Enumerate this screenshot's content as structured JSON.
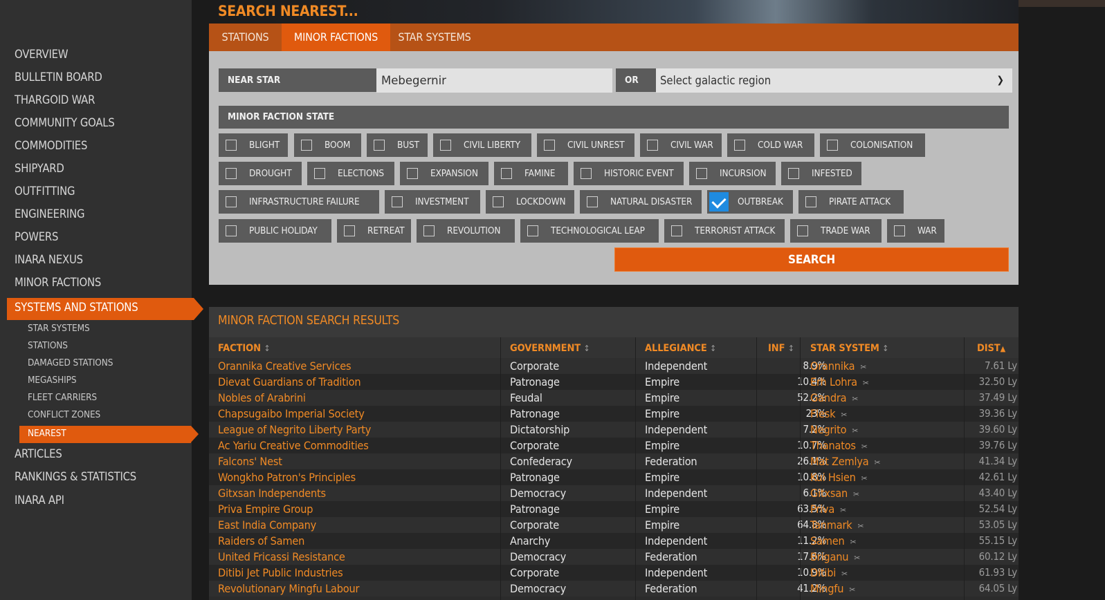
{
  "sidebar": {
    "items": [
      {
        "label": "OVERVIEW"
      },
      {
        "label": "BULLETIN BOARD"
      },
      {
        "label": "THARGOID WAR"
      },
      {
        "label": "COMMUNITY GOALS"
      },
      {
        "label": "COMMODITIES"
      },
      {
        "label": "SHIPYARD"
      },
      {
        "label": "OUTFITTING"
      },
      {
        "label": "ENGINEERING"
      },
      {
        "label": "POWERS"
      },
      {
        "label": "INARA NEXUS"
      },
      {
        "label": "MINOR FACTIONS"
      },
      {
        "label": "SYSTEMS AND STATIONS",
        "active": true
      },
      {
        "label": "ARTICLES"
      },
      {
        "label": "RANKINGS & STATISTICS"
      },
      {
        "label": "INARA API"
      }
    ],
    "subitems": [
      {
        "label": "STAR SYSTEMS"
      },
      {
        "label": "STATIONS"
      },
      {
        "label": "DAMAGED STATIONS"
      },
      {
        "label": "MEGASHIPS"
      },
      {
        "label": "FLEET CARRIERS"
      },
      {
        "label": "CONFLICT ZONES"
      },
      {
        "label": "NEAREST",
        "active": true
      }
    ]
  },
  "header": {
    "title": "SEARCH NEAREST..."
  },
  "tabs": [
    {
      "label": "STATIONS"
    },
    {
      "label": "MINOR FACTIONS",
      "active": true
    },
    {
      "label": "STAR SYSTEMS"
    }
  ],
  "form": {
    "near_star_label": "NEAR STAR",
    "near_star_value": "Mebegernir",
    "or_label": "OR",
    "region_select": "Select galactic region",
    "state_label": "MINOR FACTION STATE",
    "states": [
      {
        "label": "BLIGHT",
        "checked": false
      },
      {
        "label": "BOOM",
        "checked": false
      },
      {
        "label": "BUST",
        "checked": false
      },
      {
        "label": "CIVIL LIBERTY",
        "checked": false
      },
      {
        "label": "CIVIL UNREST",
        "checked": false
      },
      {
        "label": "CIVIL WAR",
        "checked": false
      },
      {
        "label": "COLD WAR",
        "checked": false
      },
      {
        "label": "COLONISATION",
        "checked": false
      },
      {
        "label": "DROUGHT",
        "checked": false
      },
      {
        "label": "ELECTIONS",
        "checked": false
      },
      {
        "label": "EXPANSION",
        "checked": false
      },
      {
        "label": "FAMINE",
        "checked": false
      },
      {
        "label": "HISTORIC EVENT",
        "checked": false
      },
      {
        "label": "INCURSION",
        "checked": false
      },
      {
        "label": "INFESTED",
        "checked": false
      },
      {
        "label": "INFRASTRUCTURE FAILURE",
        "checked": false
      },
      {
        "label": "INVESTMENT",
        "checked": false
      },
      {
        "label": "LOCKDOWN",
        "checked": false
      },
      {
        "label": "NATURAL DISASTER",
        "checked": false
      },
      {
        "label": "OUTBREAK",
        "checked": true
      },
      {
        "label": "PIRATE ATTACK",
        "checked": false
      },
      {
        "label": "PUBLIC HOLIDAY",
        "checked": false
      },
      {
        "label": "RETREAT",
        "checked": false
      },
      {
        "label": "REVOLUTION",
        "checked": false
      },
      {
        "label": "TECHNOLOGICAL LEAP",
        "checked": false
      },
      {
        "label": "TERRORIST ATTACK",
        "checked": false
      },
      {
        "label": "TRADE WAR",
        "checked": false
      },
      {
        "label": "WAR",
        "checked": false
      }
    ],
    "search_label": "SEARCH"
  },
  "results": {
    "title": "MINOR FACTION SEARCH RESULTS",
    "columns": [
      "FACTION",
      "GOVERNMENT",
      "ALLEGIANCE",
      "INF",
      "STAR SYSTEM",
      "DIST"
    ],
    "rows": [
      [
        "Orannika Creative Services",
        "Corporate",
        "Independent",
        "8.9%",
        "Orannika",
        "7.61 Ly"
      ],
      [
        "Dievat Guardians of Tradition",
        "Patronage",
        "Empire",
        "10.4%",
        "Erh Lohra",
        "32.50 Ly"
      ],
      [
        "Nobles of Arabrini",
        "Feudal",
        "Empire",
        "52.2%",
        "Gandra",
        "37.49 Ly"
      ],
      [
        "Chapsugaibo Imperial Society",
        "Patronage",
        "Empire",
        "23%",
        "Flesk",
        "39.36 Ly"
      ],
      [
        "League of Negrito Liberty Party",
        "Dictatorship",
        "Independent",
        "7.2%",
        "Negrito",
        "39.60 Ly"
      ],
      [
        "Ac Yariu Creative Commodities",
        "Corporate",
        "Empire",
        "10.7%",
        "Thanatos",
        "39.76 Ly"
      ],
      [
        "Falcons' Nest",
        "Confederacy",
        "Federation",
        "26.1%",
        "Mat Zemlya",
        "41.34 Ly"
      ],
      [
        "Wongkho Patron's Principles",
        "Patronage",
        "Empire",
        "10.8%",
        "Kui Hsien",
        "42.61 Ly"
      ],
      [
        "Gitxsan Independents",
        "Democracy",
        "Independent",
        "6.1%",
        "Gitxsan",
        "43.40 Ly"
      ],
      [
        "Priva Empire Group",
        "Patronage",
        "Empire",
        "63.5%",
        "Priva",
        "52.54 Ly"
      ],
      [
        "East India Company",
        "Corporate",
        "Empire",
        "64.8%",
        "Tanmark",
        "53.05 Ly"
      ],
      [
        "Raiders of Samen",
        "Anarchy",
        "Independent",
        "11.2%",
        "Samen",
        "55.15 Ly"
      ],
      [
        "United Fricassi Resistance",
        "Democracy",
        "Federation",
        "17.6%",
        "Briganu",
        "60.12 Ly"
      ],
      [
        "Ditibi Jet Public Industries",
        "Corporate",
        "Independent",
        "10.9%",
        "Ditibi",
        "61.93 Ly"
      ],
      [
        "Revolutionary Mingfu Labour",
        "Democracy",
        "Federation",
        "41.2%",
        "Mingfu",
        "64.05 Ly"
      ]
    ]
  },
  "colors": {
    "accent": "#e05a0e",
    "link": "#f08a25",
    "check": "#1f8be0"
  }
}
